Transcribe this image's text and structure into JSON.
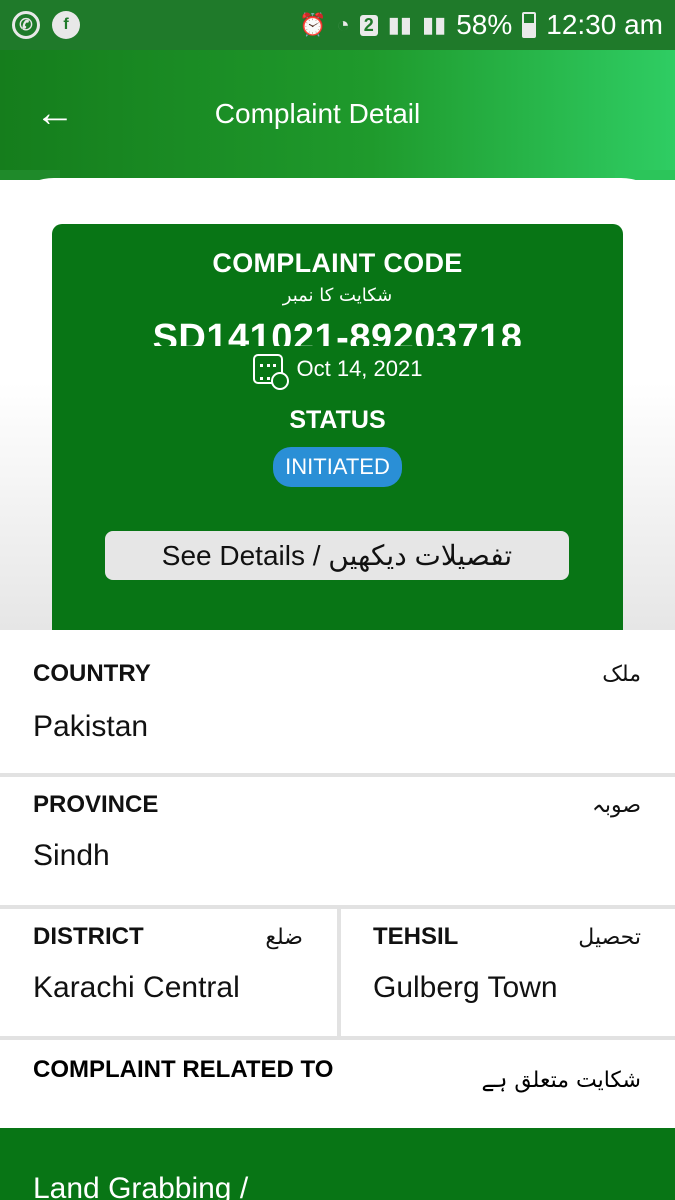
{
  "status_bar": {
    "battery": "58%",
    "time": "12:30 am",
    "sim_badge": "2"
  },
  "header": {
    "title": "Complaint Detail"
  },
  "complaint": {
    "code_title": "COMPLAINT CODE",
    "code_title_urdu": "شکایت کا نمبر",
    "code": "SD141021-89203718",
    "date": "Oct 14, 2021",
    "status_label": "STATUS",
    "status": "INITIATED",
    "details_button": "See Details / تفصیلات دیکھیں"
  },
  "fields": {
    "country": {
      "label": "COUNTRY",
      "label_urdu": "ملک",
      "value": "Pakistan"
    },
    "province": {
      "label": "PROVINCE",
      "label_urdu": "صوبہ",
      "value": "Sindh"
    },
    "district": {
      "label": "DISTRICT",
      "label_urdu": "ضلع",
      "value": "Karachi Central"
    },
    "tehsil": {
      "label": "TEHSIL",
      "label_urdu": "تحصیل",
      "value": "Gulberg Town"
    },
    "related": {
      "label": "COMPLAINT RELATED TO",
      "label_urdu": "شکایت متعلق ہے",
      "value": "Land Grabbing /"
    }
  },
  "colors": {
    "primary_green": "#087515",
    "status_blue": "#2a8fd6"
  }
}
